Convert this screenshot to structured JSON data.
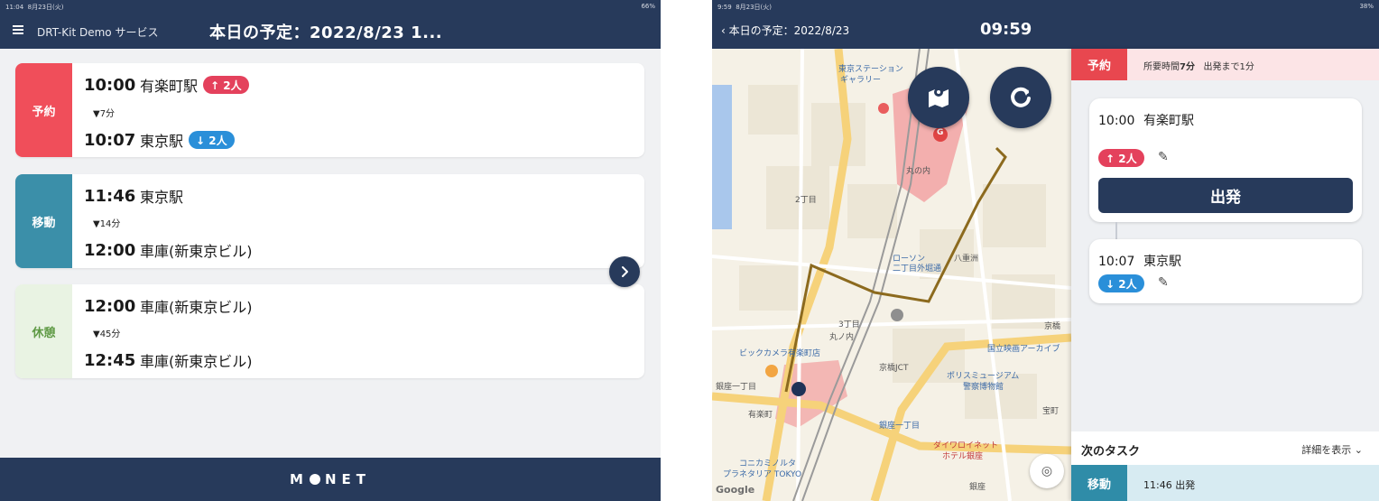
{
  "colors": {
    "navy": "#273a5b",
    "reservation_red": "#f04e5a",
    "move_teal": "#3b8fa9",
    "rest_green_bg": "#e9f3e3",
    "rest_green_text": "#5f9a45",
    "pickup_pink": "#e4415c",
    "dropoff_blue": "#2a8fd9"
  },
  "left": {
    "status": {
      "time": "11:04",
      "date": "8月23日(火)",
      "battery": "66%"
    },
    "header": {
      "app_name": "DRT-Kit Demo サービス",
      "title": "本日の予定：2022/8/23 1..."
    },
    "cards": [
      {
        "tag": "予約",
        "from_time": "10:00",
        "from_place": "有楽町駅",
        "from_badge": "↑ 2人",
        "duration": "▼7分",
        "to_time": "10:07",
        "to_place": "東京駅",
        "to_badge": "↓ 2人"
      },
      {
        "tag": "移動",
        "from_time": "11:46",
        "from_place": "東京駅",
        "duration": "▼14分",
        "to_time": "12:00",
        "to_place": "車庫(新東京ビル)"
      },
      {
        "tag": "休憩",
        "from_time": "12:00",
        "from_place": "車庫(新東京ビル)",
        "duration": "▼45分",
        "to_time": "12:45",
        "to_place": "車庫(新東京ビル)"
      }
    ],
    "next_icon": "chevron-right-icon",
    "footer_logo": "M  NET"
  },
  "right": {
    "status": {
      "time": "9:59",
      "date": "8月23日(火)",
      "battery": "38%"
    },
    "back_label": "本日の予定：2022/8/23",
    "clock": "09:59",
    "map": {
      "labels": [
        "東京ステーション",
        "ギャラリー",
        "丸の内",
        "2丁目",
        "3丁目",
        "丸ノ内",
        "有楽町",
        "ビックカメラ有楽町店",
        "国立映画アーカイブ",
        "ポリスミュージアム",
        "警察博物館",
        "銀座一丁目",
        "ダイワロイネット",
        "ホテル銀座",
        "コニカミノルタ",
        "プラネタリア TOKYO",
        "京橋",
        "八重洲",
        "ローソン",
        "二丁目外堀通",
        "京橋JCT",
        "宝町",
        "銀座",
        "銀座一丁目",
        "G"
      ],
      "google": "Google"
    },
    "reservation": {
      "tag": "予約",
      "info_prefix": "所要時間",
      "info_duration": "7分",
      "info_depart": "出発まで1分"
    },
    "stop1": {
      "time": "10:00",
      "place": "有楽町駅",
      "badge": "↑ 2人",
      "button": "出発"
    },
    "stop2": {
      "time": "10:07",
      "place": "東京駅",
      "badge": "↓ 2人"
    },
    "next_task": {
      "label": "次のタスク",
      "more": "詳細を表示 ⌄",
      "tag": "移動",
      "text": "11:46 出発"
    }
  }
}
